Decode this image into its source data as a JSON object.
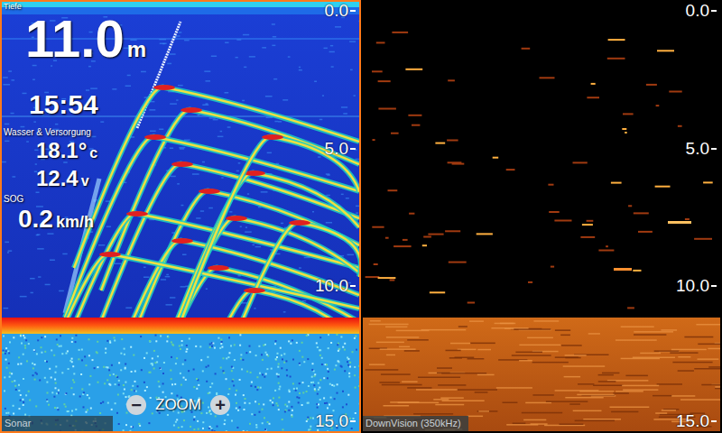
{
  "panels": [
    {
      "label": "Sonar",
      "selected": true,
      "kind": "sonar",
      "scale": [
        "0.0",
        "5.0",
        "10.0",
        "15.0"
      ]
    },
    {
      "label": "DownVision (350kHz)",
      "selected": false,
      "kind": "downvision",
      "scale": [
        "0.0",
        "5.0",
        "10.0",
        "15.0"
      ]
    }
  ],
  "depth": {
    "label": "Tiefe",
    "value": "11.0",
    "unit": "m"
  },
  "time": "15:54",
  "water": {
    "label": "Wasser & Versorgung",
    "temperature": "18.1°",
    "temperature_unit": "c",
    "voltage": "12.4",
    "voltage_unit": "v"
  },
  "sog": {
    "label": "SOG",
    "value": "0.2",
    "unit": "km/h"
  },
  "zoom": {
    "label": "ZOOM",
    "minus": "−",
    "plus": "+"
  }
}
